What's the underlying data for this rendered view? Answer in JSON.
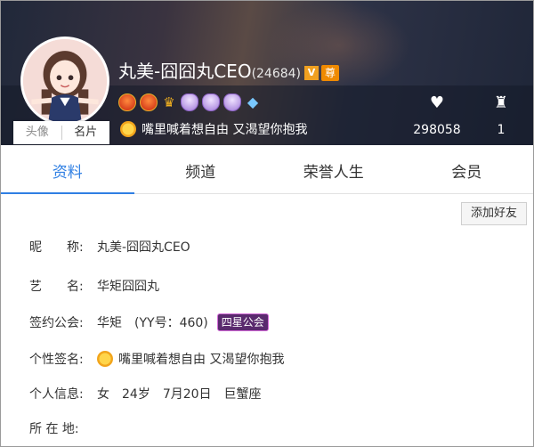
{
  "profile": {
    "nickname": "丸美-囧囧丸CEO",
    "uid": "(24684)",
    "v_badge": "V",
    "zun_badge": "尊",
    "signature": "嘴里喊着想自由 又渴望你抱我",
    "avatar_tabs": [
      "头像",
      "名片"
    ]
  },
  "badges": [
    "red-medal",
    "red-medal",
    "crown",
    "purple-shield",
    "purple-shield",
    "purple-shield",
    "diamond"
  ],
  "stats": {
    "likes": "298058",
    "rank": "1",
    "likes_icon": "heart-icon",
    "rank_icon": "trophy-icon"
  },
  "tabs": [
    "资料",
    "频道",
    "荣誉人生",
    "会员"
  ],
  "add_friend": "添加好友",
  "info": {
    "nickname_label": "昵　　称:",
    "nickname_value": "丸美-囧囧丸CEO",
    "stage_label": "艺　　名:",
    "stage_value": "华矩囧囧丸",
    "guild_label": "签约公会:",
    "guild_value": "华矩　(YY号：460)",
    "guild_badge": "四星公会",
    "sig_label": "个性签名:",
    "sig_value": "嘴里喊着想自由 又渴望你抱我",
    "personal_label": "个人信息:",
    "personal_value": "女　24岁　7月20日　巨蟹座",
    "location_label": "所 在 地:"
  },
  "colors": {
    "accent": "#2f7fe3",
    "banner": "#1f2638",
    "vip": "#f08a00"
  }
}
